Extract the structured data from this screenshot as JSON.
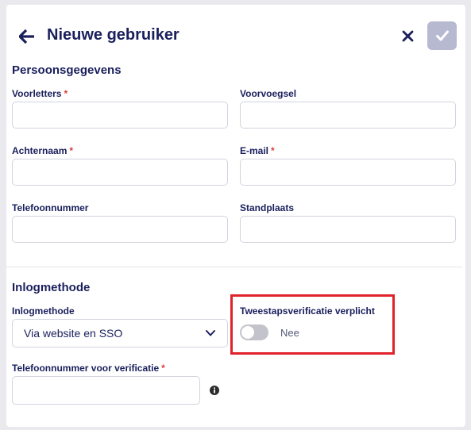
{
  "header": {
    "title": "Nieuwe gebruiker"
  },
  "sections": {
    "personal": "Persoonsgegevens",
    "login": "Inlogmethode"
  },
  "fields": {
    "initials": {
      "label": "Voorletters",
      "value": "",
      "required": true
    },
    "prefix": {
      "label": "Voorvoegsel",
      "value": "",
      "required": false
    },
    "lastname": {
      "label": "Achternaam",
      "value": "",
      "required": true
    },
    "email": {
      "label": "E-mail",
      "value": "",
      "required": true
    },
    "phone": {
      "label": "Telefoonnummer",
      "value": "",
      "required": false
    },
    "location": {
      "label": "Standplaats",
      "value": "",
      "required": false
    },
    "login_method": {
      "label": "Inlogmethode",
      "value": "Via website en SSO"
    },
    "two_factor": {
      "label": "Tweestapsverificatie verplicht",
      "state_text": "Nee",
      "enabled": false
    },
    "verification_phone": {
      "label": "Telefoonnummer voor verificatie",
      "value": "",
      "required": true
    }
  },
  "required_marker": "*",
  "icons": {
    "back": "arrow-left-icon",
    "close": "close-icon",
    "confirm": "check-icon",
    "dropdown": "chevron-down-icon",
    "info": "info-icon"
  },
  "colors": {
    "primary": "#1a1f5c",
    "confirm_disabled": "#b7b9d1",
    "required": "#d9403a",
    "highlight": "#e0222b"
  }
}
